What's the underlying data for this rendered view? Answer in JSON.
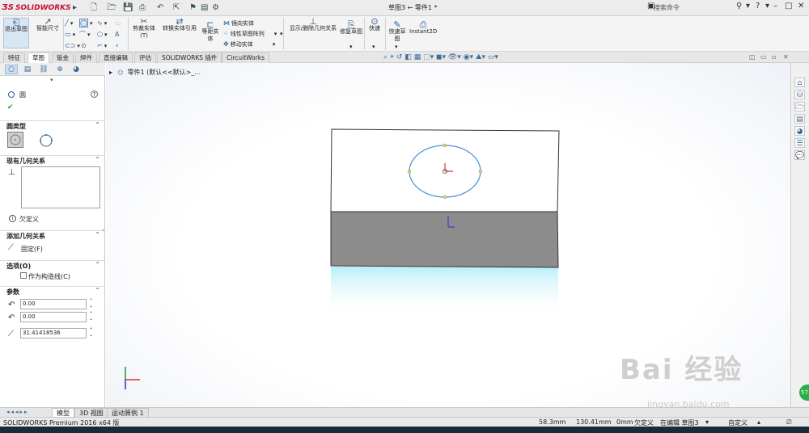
{
  "titlebar": {
    "brand": "SOLIDWORKS",
    "document_title": "草图3 ← 零件1 *",
    "search_placeholder": "搜索命令",
    "help": "?",
    "minimize": "–",
    "restore": "□",
    "close": "✕"
  },
  "ribbon": {
    "exit_sketch": "退出草图",
    "smart_dimension": "智能尺寸",
    "trim_entities": "剪裁实体(T)",
    "convert_entities": "转换实体引用",
    "offset_entities": "等距实体",
    "mirror_entities": "镜向实体",
    "linear_pattern": "线性草图阵列",
    "move_entities": "移动实体",
    "display_relations": "显示/删除几何关系",
    "repair_sketch": "修复草图",
    "quick_snaps": "快速",
    "rapid_sketch": "快速草图",
    "instant2d": "Instant2D"
  },
  "tabs": [
    "特征",
    "草图",
    "钣金",
    "焊件",
    "直接编辑",
    "评估",
    "SOLIDWORKS 插件",
    "CircuitWorks"
  ],
  "active_tab": "草图",
  "panel": {
    "title": "圆",
    "circle_type_header": "圆类型",
    "existing_relations_header": "现有几何关系",
    "status_text": "欠定义",
    "add_relations_header": "添加几何关系",
    "fix_label": "固定(F)",
    "options_header": "选项(O)",
    "construction_label": "作为构造线(C)",
    "parameters_header": "参数",
    "param_x": "0.00",
    "param_y": "0.00",
    "param_r": "31.41418536"
  },
  "tree": {
    "item": "零件1 (默认<<默认>_..."
  },
  "bottom_tabs": [
    "模型",
    "3D 视图",
    "运动算例 1"
  ],
  "active_bottom_tab": "模型",
  "status": {
    "product": "SOLIDWORKS Premium 2016 x64 版",
    "x": "58.3mm",
    "y": "130.41mm",
    "z": "0mm",
    "state": "欠定义",
    "editing": "在编辑 草图3",
    "custom": "自定义"
  },
  "watermark": {
    "brand": "Bai 经验",
    "url": "jingyan.baidu.com",
    "badge": "57"
  },
  "colors": {
    "sketch_circle": "#4a8fd6",
    "block_top": "#ffffff",
    "block_front": "#8c8c8c",
    "reflection": "#bff0fb",
    "axis_x": "#e0332b",
    "axis_y": "#2f9a3a",
    "axis_z": "#2a3fcf",
    "sketch_point": "#e7e14a"
  }
}
